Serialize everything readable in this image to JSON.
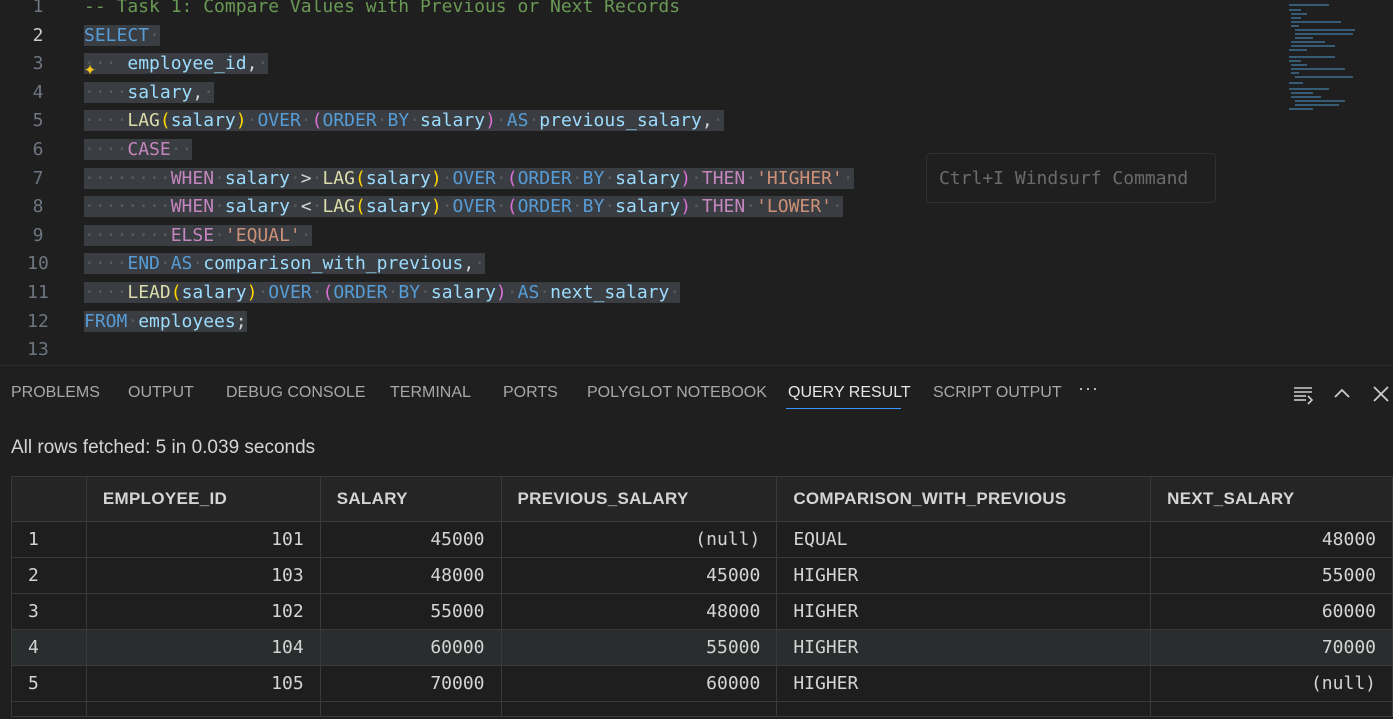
{
  "editor": {
    "line_numbers": [
      "1",
      "2",
      "3",
      "4",
      "5",
      "6",
      "7",
      "8",
      "9",
      "10",
      "11",
      "12",
      "13"
    ],
    "code": {
      "l1": "-- Task 1: Compare Values with Previous or Next Records",
      "select": "SELECT",
      "employee_id": "employee_id",
      "salary": "salary",
      "lag": "LAG",
      "lead": "LEAD",
      "over": "OVER",
      "order": "ORDER",
      "by": "BY",
      "as": "AS",
      "previous_salary": "previous_salary",
      "case": "CASE",
      "when": "WHEN",
      "then": "THEN",
      "else": "ELSE",
      "end": "END",
      "higher": "'HIGHER'",
      "lower": "'LOWER'",
      "equal": "'EQUAL'",
      "gt": ">",
      "lt": "<",
      "comparison_with_previous": "comparison_with_previous",
      "next_salary": "next_salary",
      "from": "FROM",
      "employees": "employees"
    },
    "command_hint": "Ctrl+I Windsurf Command",
    "sparkle_icon": "sparkle-icon"
  },
  "panel": {
    "tabs": [
      "PROBLEMS",
      "OUTPUT",
      "DEBUG CONSOLE",
      "TERMINAL",
      "PORTS",
      "POLYGLOT NOTEBOOK",
      "QUERY RESULT",
      "SCRIPT OUTPUT"
    ],
    "more": "···",
    "status": "All rows fetched: 5 in 0.039 seconds",
    "columns": [
      "EMPLOYEE_ID",
      "SALARY",
      "PREVIOUS_SALARY",
      "COMPARISON_WITH_PREVIOUS",
      "NEXT_SALARY"
    ],
    "rows": [
      [
        "1",
        "101",
        "45000",
        "(null)",
        "EQUAL",
        "48000"
      ],
      [
        "2",
        "103",
        "48000",
        "45000",
        "HIGHER",
        "55000"
      ],
      [
        "3",
        "102",
        "55000",
        "48000",
        "HIGHER",
        "60000"
      ],
      [
        "4",
        "104",
        "60000",
        "55000",
        "HIGHER",
        "70000"
      ],
      [
        "5",
        "105",
        "70000",
        "60000",
        "HIGHER",
        "(null)"
      ]
    ]
  },
  "colors": {
    "accent": "#3794ff",
    "background": "#1f1f1f",
    "keyword": "#569cd6",
    "control_keyword": "#c586c0",
    "function": "#dcdcaa",
    "identifier": "#9cdcfe",
    "string": "#ce9178",
    "comment": "#6a9955"
  }
}
